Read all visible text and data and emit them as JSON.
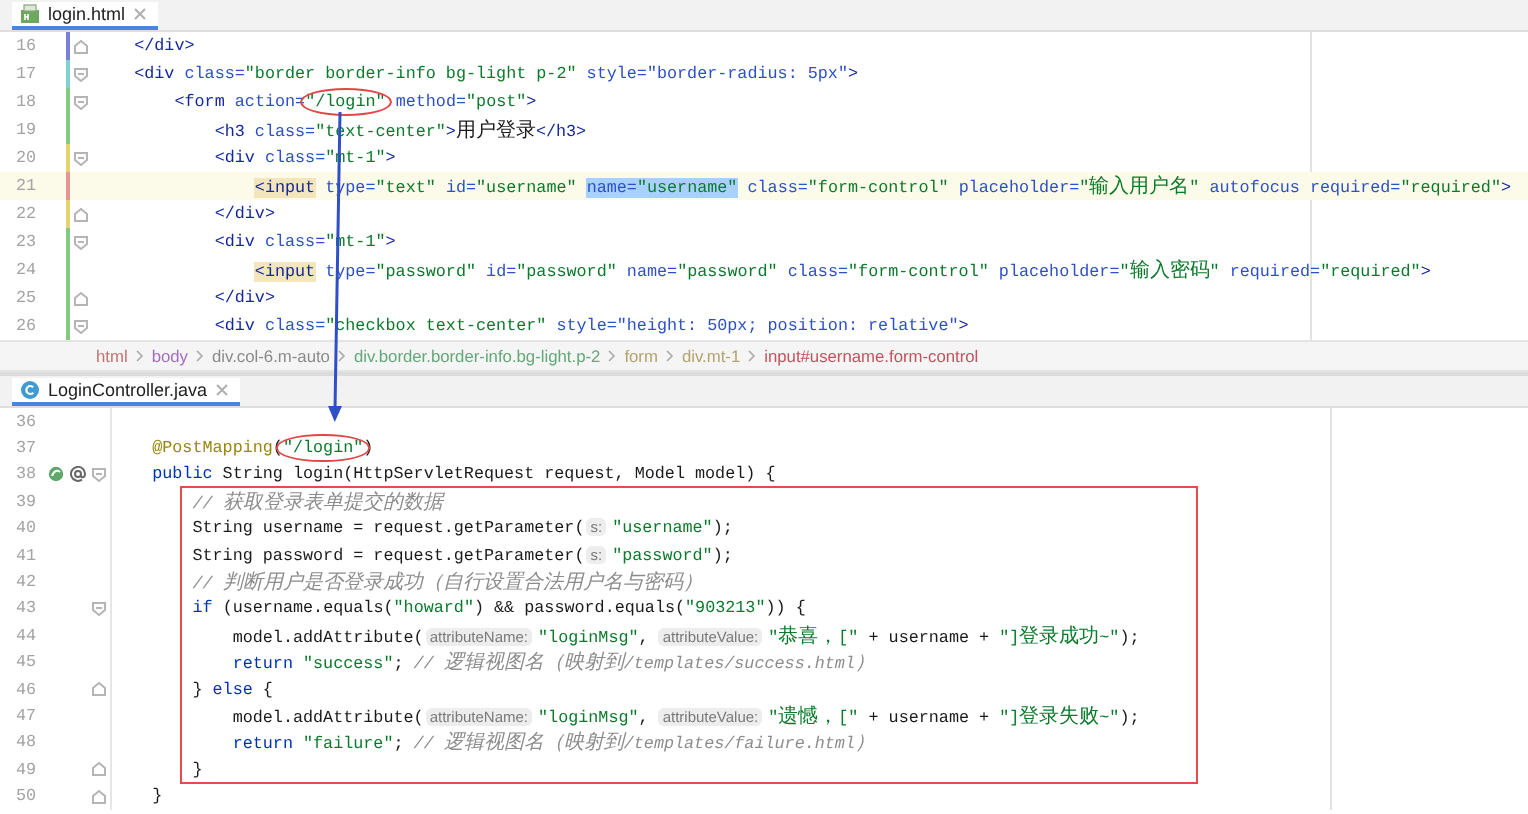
{
  "editors": [
    {
      "tab": {
        "title": "login.html"
      },
      "lines": [
        {
          "number": "16",
          "color": "#7a7fdc",
          "fold_start": false,
          "fold_end": true,
          "current": false,
          "tokens": [
            {
              "kind": "tag",
              "text": "    </div>"
            }
          ]
        },
        {
          "number": "17",
          "color": "#7fd0d0",
          "fold_start": true,
          "fold_end": false,
          "current": false,
          "tokens": [
            {
              "kind": "tag",
              "text": "    <div"
            },
            {
              "kind": "attr",
              "text": " class="
            },
            {
              "kind": "str",
              "text": "\"border border-info bg-light p-2\""
            },
            {
              "kind": "attr",
              "text": " style="
            },
            {
              "kind": "css",
              "text": "\"border-radius: 5px\""
            },
            {
              "kind": "tag",
              "text": ">"
            }
          ]
        },
        {
          "number": "18",
          "color": "#83c983",
          "fold_start": true,
          "fold_end": false,
          "current": false,
          "tokens": [
            {
              "kind": "tag",
              "text": "        <form"
            },
            {
              "kind": "attr",
              "text": " action="
            },
            {
              "kind": "str",
              "text": "\"/login\"",
              "circled": true
            },
            {
              "kind": "attr",
              "text": " method="
            },
            {
              "kind": "str",
              "text": "\"post\""
            },
            {
              "kind": "tag",
              "text": ">"
            }
          ]
        },
        {
          "number": "19",
          "color": "#83c983",
          "fold_start": false,
          "fold_end": false,
          "current": false,
          "tokens": [
            {
              "kind": "tag",
              "text": "            <h3"
            },
            {
              "kind": "attr",
              "text": " class="
            },
            {
              "kind": "str",
              "text": "\"text-center\""
            },
            {
              "kind": "tag",
              "text": ">"
            },
            {
              "kind": "text",
              "text": "用户登录"
            },
            {
              "kind": "tag",
              "text": "</h3>"
            }
          ]
        },
        {
          "number": "20",
          "color": "#e3d56e",
          "fold_start": true,
          "fold_end": false,
          "current": false,
          "tokens": [
            {
              "kind": "tag",
              "text": "            <div"
            },
            {
              "kind": "attr",
              "text": " class="
            },
            {
              "kind": "str",
              "text": "\"mt-1\""
            },
            {
              "kind": "tag",
              "text": ">"
            }
          ]
        },
        {
          "number": "21",
          "color": "#e89494",
          "fold_start": false,
          "fold_end": false,
          "current": true,
          "tokens": [
            {
              "kind": "tag",
              "text": "                <input",
              "marked": true
            },
            {
              "kind": "attr",
              "text": " type="
            },
            {
              "kind": "str",
              "text": "\"text\""
            },
            {
              "kind": "attr",
              "text": " id="
            },
            {
              "kind": "str",
              "text": "\"username\""
            },
            {
              "kind": "attr",
              "text": " name=",
              "selected": true
            },
            {
              "kind": "str",
              "text": "\"username\"",
              "selected": true
            },
            {
              "kind": "attr",
              "text": " class="
            },
            {
              "kind": "str",
              "text": "\"form-control\""
            },
            {
              "kind": "attr",
              "text": " placeholder="
            },
            {
              "kind": "str",
              "text": "\"输入用户名\""
            },
            {
              "kind": "attr",
              "text": " autofocus required="
            },
            {
              "kind": "str",
              "text": "\"required\""
            },
            {
              "kind": "tag",
              "text": ">"
            }
          ]
        },
        {
          "number": "22",
          "color": "#e3d56e",
          "fold_start": false,
          "fold_end": true,
          "current": false,
          "tokens": [
            {
              "kind": "tag",
              "text": "            </div>"
            }
          ]
        },
        {
          "number": "23",
          "color": "#83c983",
          "fold_start": true,
          "fold_end": false,
          "current": false,
          "tokens": [
            {
              "kind": "tag",
              "text": "            <div"
            },
            {
              "kind": "attr",
              "text": " class="
            },
            {
              "kind": "str",
              "text": "\"mt-1\""
            },
            {
              "kind": "tag",
              "text": ">"
            }
          ]
        },
        {
          "number": "24",
          "color": "#83c983",
          "fold_start": false,
          "fold_end": false,
          "current": false,
          "tokens": [
            {
              "kind": "tag",
              "text": "                <input",
              "marked": true
            },
            {
              "kind": "attr",
              "text": " type="
            },
            {
              "kind": "str",
              "text": "\"password\""
            },
            {
              "kind": "attr",
              "text": " id="
            },
            {
              "kind": "str",
              "text": "\"password\""
            },
            {
              "kind": "attr",
              "text": " name="
            },
            {
              "kind": "str",
              "text": "\"password\""
            },
            {
              "kind": "attr",
              "text": " class="
            },
            {
              "kind": "str",
              "text": "\"form-control\""
            },
            {
              "kind": "attr",
              "text": " placeholder="
            },
            {
              "kind": "str",
              "text": "\"输入密码\""
            },
            {
              "kind": "attr",
              "text": " required="
            },
            {
              "kind": "str",
              "text": "\"required\""
            },
            {
              "kind": "tag",
              "text": ">"
            }
          ]
        },
        {
          "number": "25",
          "color": "#83c983",
          "fold_start": false,
          "fold_end": true,
          "current": false,
          "tokens": [
            {
              "kind": "tag",
              "text": "            </div>"
            }
          ]
        },
        {
          "number": "26",
          "color": "#83c983",
          "fold_start": true,
          "fold_end": false,
          "current": false,
          "tokens": [
            {
              "kind": "tag",
              "text": "            <div"
            },
            {
              "kind": "attr",
              "text": " class="
            },
            {
              "kind": "str",
              "text": "\"checkbox text-center\""
            },
            {
              "kind": "attr",
              "text": " style="
            },
            {
              "kind": "css",
              "text": "\"height: 50px; position: relative\""
            },
            {
              "kind": "tag",
              "text": ">"
            }
          ]
        }
      ],
      "breadcrumbs": [
        {
          "label": "html",
          "color": "#c47272"
        },
        {
          "label": "body",
          "color": "#a46fc2"
        },
        {
          "label": "div.col-6.m-auto",
          "color": "#8a8a8a"
        },
        {
          "label": "div.border.border-info.bg-light.p-2",
          "color": "#62a878"
        },
        {
          "label": "form",
          "color": "#b3a36c"
        },
        {
          "label": "div.mt-1",
          "color": "#b3a36c"
        },
        {
          "label": "input#username.form-control",
          "color": "#c4525e"
        }
      ]
    },
    {
      "tab": {
        "title": "LoginController.java"
      },
      "lines_before": [
        {
          "number": "36",
          "fold_start": false,
          "fold_end": false
        },
        {
          "number": "37",
          "fold_start": false,
          "fold_end": false,
          "tokens": [
            {
              "kind": "ann",
              "text": "    @PostMapping"
            },
            {
              "kind": "text",
              "text": "("
            },
            {
              "kind": "str",
              "text": "\"/login\"",
              "circled": true
            },
            {
              "kind": "text",
              "text": ")"
            }
          ]
        },
        {
          "number": "38",
          "fold_start": true,
          "fold_end": false,
          "markers": [
            {
              "kind": "bean"
            },
            {
              "kind": "at"
            }
          ],
          "tokens": [
            {
              "kind": "kw",
              "text": "    public"
            },
            {
              "kind": "text",
              "text": " String login(HttpServletRequest request, Model model) {"
            }
          ]
        }
      ],
      "boxed_lines": [
        {
          "number": "39",
          "fold_start": false,
          "fold_end": false,
          "tokens": [
            {
              "kind": "cmt",
              "text": "        // 获取登录表单提交的数据"
            }
          ]
        },
        {
          "number": "40",
          "fold_start": false,
          "fold_end": false,
          "tokens": [
            {
              "kind": "text",
              "text": "        String username = request.getParameter("
            },
            {
              "kind": "hint",
              "text": "s:"
            },
            {
              "kind": "str",
              "text": "\"username\""
            },
            {
              "kind": "text",
              "text": ");"
            }
          ]
        },
        {
          "number": "41",
          "fold_start": false,
          "fold_end": false,
          "tokens": [
            {
              "kind": "text",
              "text": "        String password = request.getParameter("
            },
            {
              "kind": "hint",
              "text": "s:"
            },
            {
              "kind": "str",
              "text": "\"password\""
            },
            {
              "kind": "text",
              "text": ");"
            }
          ]
        },
        {
          "number": "42",
          "fold_start": false,
          "fold_end": false,
          "tokens": [
            {
              "kind": "cmt",
              "text": "        // 判断用户是否登录成功（自行设置合法用户名与密码）"
            }
          ]
        },
        {
          "number": "43",
          "fold_start": true,
          "fold_end": false,
          "tokens": [
            {
              "kind": "kw",
              "text": "        if"
            },
            {
              "kind": "text",
              "text": " (username.equals("
            },
            {
              "kind": "str",
              "text": "\"howard\""
            },
            {
              "kind": "text",
              "text": ") && password.equals("
            },
            {
              "kind": "str",
              "text": "\"903213\""
            },
            {
              "kind": "text",
              "text": ")) {"
            }
          ]
        },
        {
          "number": "44",
          "fold_start": false,
          "fold_end": false,
          "tokens": [
            {
              "kind": "text",
              "text": "            model.addAttribute("
            },
            {
              "kind": "hint",
              "text": "attributeName:"
            },
            {
              "kind": "str",
              "text": "\"loginMsg\""
            },
            {
              "kind": "text",
              "text": ","
            },
            {
              "kind": "hint",
              "text": "attributeValue:"
            },
            {
              "kind": "str",
              "text": "\"恭喜，[\""
            },
            {
              "kind": "text",
              "text": " + username + "
            },
            {
              "kind": "str",
              "text": "\"]登录成功~\""
            },
            {
              "kind": "text",
              "text": ");"
            }
          ]
        },
        {
          "number": "45",
          "fold_start": false,
          "fold_end": false,
          "tokens": [
            {
              "kind": "kw",
              "text": "            return"
            },
            {
              "kind": "str",
              "text": " \"success\""
            },
            {
              "kind": "text",
              "text": ";"
            },
            {
              "kind": "cmt",
              "text": " // 逻辑视图名（映射到/templates/success.html）"
            }
          ]
        },
        {
          "number": "46",
          "fold_start": false,
          "fold_end": true,
          "tokens": [
            {
              "kind": "text",
              "text": "        }"
            },
            {
              "kind": "kw",
              "text": " else"
            },
            {
              "kind": "text",
              "text": " {"
            }
          ]
        },
        {
          "number": "47",
          "fold_start": false,
          "fold_end": false,
          "tokens": [
            {
              "kind": "text",
              "text": "            model.addAttribute("
            },
            {
              "kind": "hint",
              "text": "attributeName:"
            },
            {
              "kind": "str",
              "text": "\"loginMsg\""
            },
            {
              "kind": "text",
              "text": ","
            },
            {
              "kind": "hint",
              "text": "attributeValue:"
            },
            {
              "kind": "str",
              "text": "\"遗憾，[\""
            },
            {
              "kind": "text",
              "text": " + username + "
            },
            {
              "kind": "str",
              "text": "\"]登录失败~\""
            },
            {
              "kind": "text",
              "text": ");"
            }
          ]
        },
        {
          "number": "48",
          "fold_start": false,
          "fold_end": false,
          "tokens": [
            {
              "kind": "kw",
              "text": "            return"
            },
            {
              "kind": "str",
              "text": " \"failure\""
            },
            {
              "kind": "text",
              "text": ";"
            },
            {
              "kind": "cmt",
              "text": " // 逻辑视图名（映射到/templates/failure.html）"
            }
          ]
        },
        {
          "number": "49",
          "fold_start": false,
          "fold_end": true,
          "tokens": [
            {
              "kind": "text",
              "text": "        }"
            }
          ]
        }
      ],
      "lines_after": [
        {
          "number": "50",
          "fold_start": false,
          "fold_end": true,
          "tokens": [
            {
              "kind": "text",
              "text": "    }"
            }
          ]
        }
      ]
    }
  ]
}
